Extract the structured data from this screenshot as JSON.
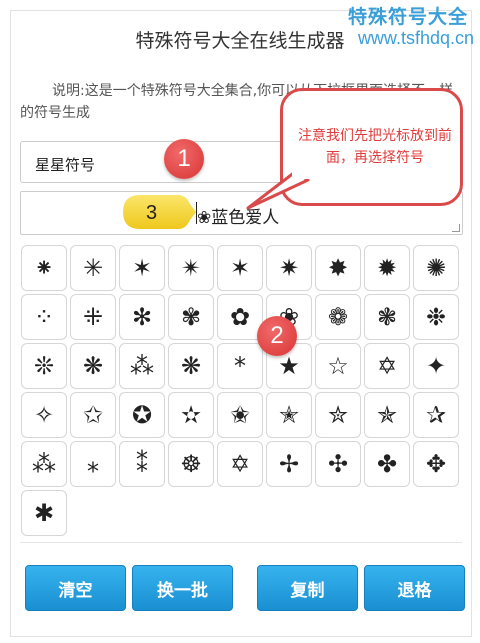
{
  "title": "特殊符号大全在线生成器",
  "watermark": {
    "line1": "特殊符号大全",
    "line2": "www.tsfhdq.cn"
  },
  "description": "说明:这是一个特殊符号大全集合,你可以从下拉框里面选择不一样的符号生成",
  "category_select": {
    "value": "星星符号"
  },
  "text_input": {
    "value": "❀蓝色爱人"
  },
  "symbols": [
    "⁕",
    "✳",
    "✶",
    "✴",
    "✶",
    "✷",
    "✸",
    "✹",
    "✺",
    "⁘",
    "⁜",
    "✻",
    "✾",
    "✿",
    "❀",
    "❁",
    "❃",
    "❉",
    "❊",
    "❋",
    "⁂",
    "❋",
    "*",
    "★",
    "☆",
    "✡",
    "✦",
    "✧",
    "✩",
    "✪",
    "✫",
    "✬",
    "✭",
    "✮",
    "✯",
    "✰",
    "⁂",
    "⁎",
    "⁑",
    "☸",
    "✡",
    "✢",
    "✣",
    "✤",
    "✥",
    "✱"
  ],
  "buttons": {
    "clear": "清空",
    "shuffle": "换一批",
    "copy": "复制",
    "backspace": "退格"
  },
  "annotations": {
    "badge1": "1",
    "badge2": "2",
    "badge3": "3",
    "callout": "注意我们先把光标放到前面，再选择符号"
  },
  "colors": {
    "accent": "#1a8fd1",
    "badge": "#d93434",
    "watermark": "#3a9fd8",
    "tag": "#f5d42a"
  }
}
